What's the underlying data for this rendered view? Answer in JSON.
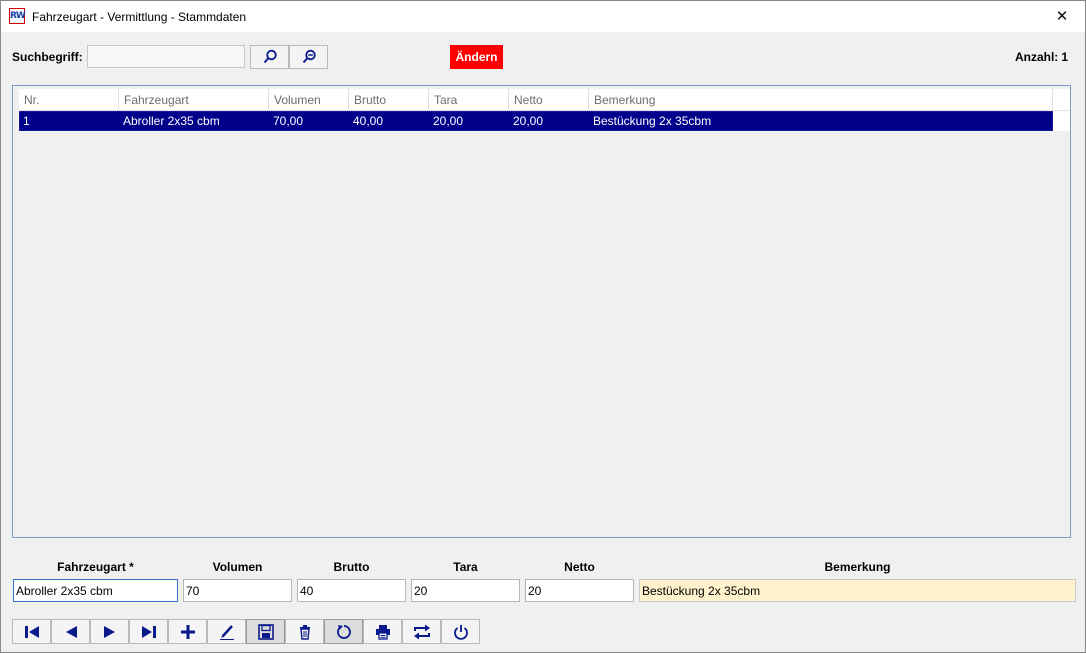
{
  "window": {
    "title": "Fahrzeugart - Vermittlung - Stammdaten",
    "app_icon_text": "RW",
    "close_glyph": "✕"
  },
  "search": {
    "label": "Suchbegriff:",
    "value": "",
    "placeholder": "",
    "search_icon": "search-icon",
    "clear_search_icon": "search-minus-icon"
  },
  "toolbar": {
    "change_label": "Ändern",
    "count_label": "Anzahl:",
    "count_value": "1"
  },
  "grid": {
    "columns": [
      "Nr.",
      "Fahrzeugart",
      "Volumen",
      "Brutto",
      "Tara",
      "Netto",
      "Bemerkung"
    ],
    "rows": [
      {
        "nr": "1",
        "fahrzeugart": "Abroller 2x35 cbm",
        "volumen": "70,00",
        "brutto": "40,00",
        "tara": "20,00",
        "netto": "20,00",
        "bemerkung": "Bestückung 2x 35cbm"
      }
    ],
    "selected_row_color": "#00008b"
  },
  "form": {
    "fahrzeugart_label": "Fahrzeugart *",
    "fahrzeugart_value": "Abroller 2x35 cbm",
    "volumen_label": "Volumen",
    "volumen_value": "70",
    "brutto_label": "Brutto",
    "brutto_value": "40",
    "tara_label": "Tara",
    "tara_value": "20",
    "netto_label": "Netto",
    "netto_value": "20",
    "bemerkung_label": "Bemerkung",
    "bemerkung_value": "Bestückung 2x 35cbm"
  },
  "navigation": {
    "buttons": [
      "first-record-icon",
      "previous-record-icon",
      "next-record-icon",
      "last-record-icon",
      "add-icon",
      "edit-icon",
      "save-icon",
      "delete-icon",
      "refresh-icon",
      "print-icon",
      "swap-icon",
      "power-icon"
    ]
  },
  "colors": {
    "accent": "#00008b",
    "change_button": "#ff0000",
    "remark_background": "#fff2cc",
    "icon": "#0a1a8c"
  }
}
